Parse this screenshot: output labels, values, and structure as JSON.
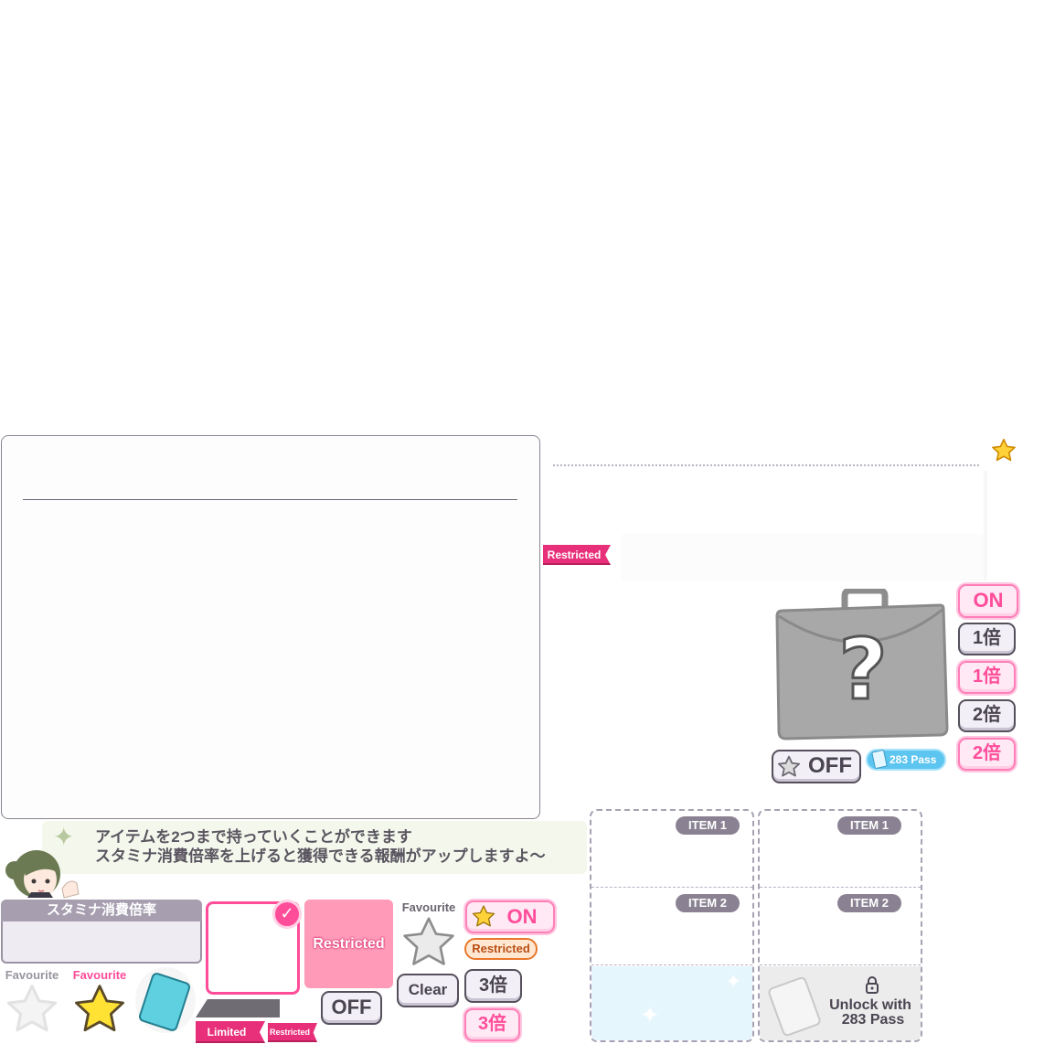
{
  "panel": {},
  "ribbons": {
    "restricted_label": "Restricted",
    "limited_label": "Limited",
    "restricted_small_label": "Restricted"
  },
  "toggle_on": "ON",
  "toggle_off": "OFF",
  "multipliers": [
    "1倍",
    "1倍",
    "2倍",
    "2倍",
    "3倍",
    "3倍"
  ],
  "pass_badge": "283 Pass",
  "slots": {
    "item1": "ITEM 1",
    "item2": "ITEM 2",
    "unlock": [
      "Unlock with",
      "283 Pass"
    ]
  },
  "speech": {
    "line1": "アイテムを2つまで持っていくことができます",
    "line2": "スタミナ消費倍率を上げると獲得できる報酬がアップしますよ～"
  },
  "stamina_header": "スタミナ消費倍率",
  "favourite": {
    "label": "Favourite"
  },
  "restricted_button": "Restricted",
  "restricted_tag": "Restricted",
  "clear_button": "Clear",
  "colors": {
    "pink": "#ff4d9a",
    "ribbon": "#e8307a",
    "gray_text": "#4a4551",
    "tag": "#8a8292"
  }
}
